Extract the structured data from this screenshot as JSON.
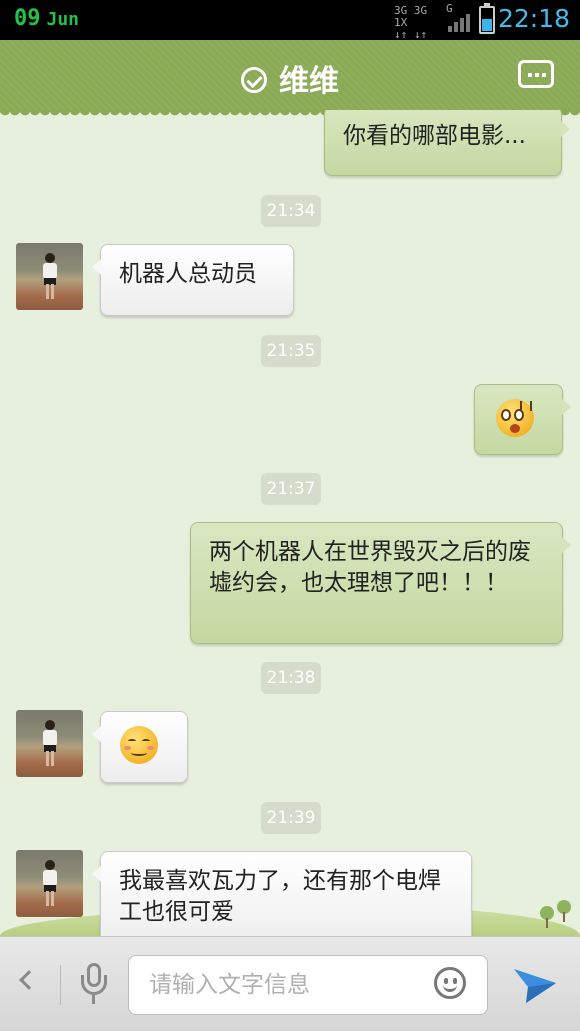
{
  "status_bar": {
    "date_day": "09",
    "date_month": "Jun",
    "network_line1": "3G 3G 1X",
    "network_line2": "↓↑ ↓↑ ↓↑",
    "network_g": "G",
    "battery_level": 0.5,
    "clock": "22:18"
  },
  "header": {
    "title": "维维"
  },
  "messages": [
    {
      "type": "out",
      "text": "你看的哪部电影..."
    },
    {
      "type": "time",
      "text": "21:34"
    },
    {
      "type": "in",
      "text": "机器人总动员"
    },
    {
      "type": "time",
      "text": "21:35"
    },
    {
      "type": "out",
      "emoji": "shocked-emoji"
    },
    {
      "type": "time",
      "text": "21:37"
    },
    {
      "type": "out",
      "text": "两个机器人在世界毁灭之后的废墟约会，也太理想了吧！！！"
    },
    {
      "type": "time",
      "text": "21:38"
    },
    {
      "type": "in",
      "emoji": "shy-emoji"
    },
    {
      "type": "time",
      "text": "21:39"
    },
    {
      "type": "in",
      "text": "我最喜欢瓦力了，还有那个电焊工也很可爱"
    }
  ],
  "input": {
    "placeholder": "请输入文字信息"
  },
  "colors": {
    "header_green": "#8aaa55",
    "chat_background": "#e7efdd",
    "outgoing_bubble": "#c8dba6",
    "incoming_bubble": "#ffffff",
    "clock_blue": "#45b9ea",
    "date_green": "#22c24a"
  }
}
